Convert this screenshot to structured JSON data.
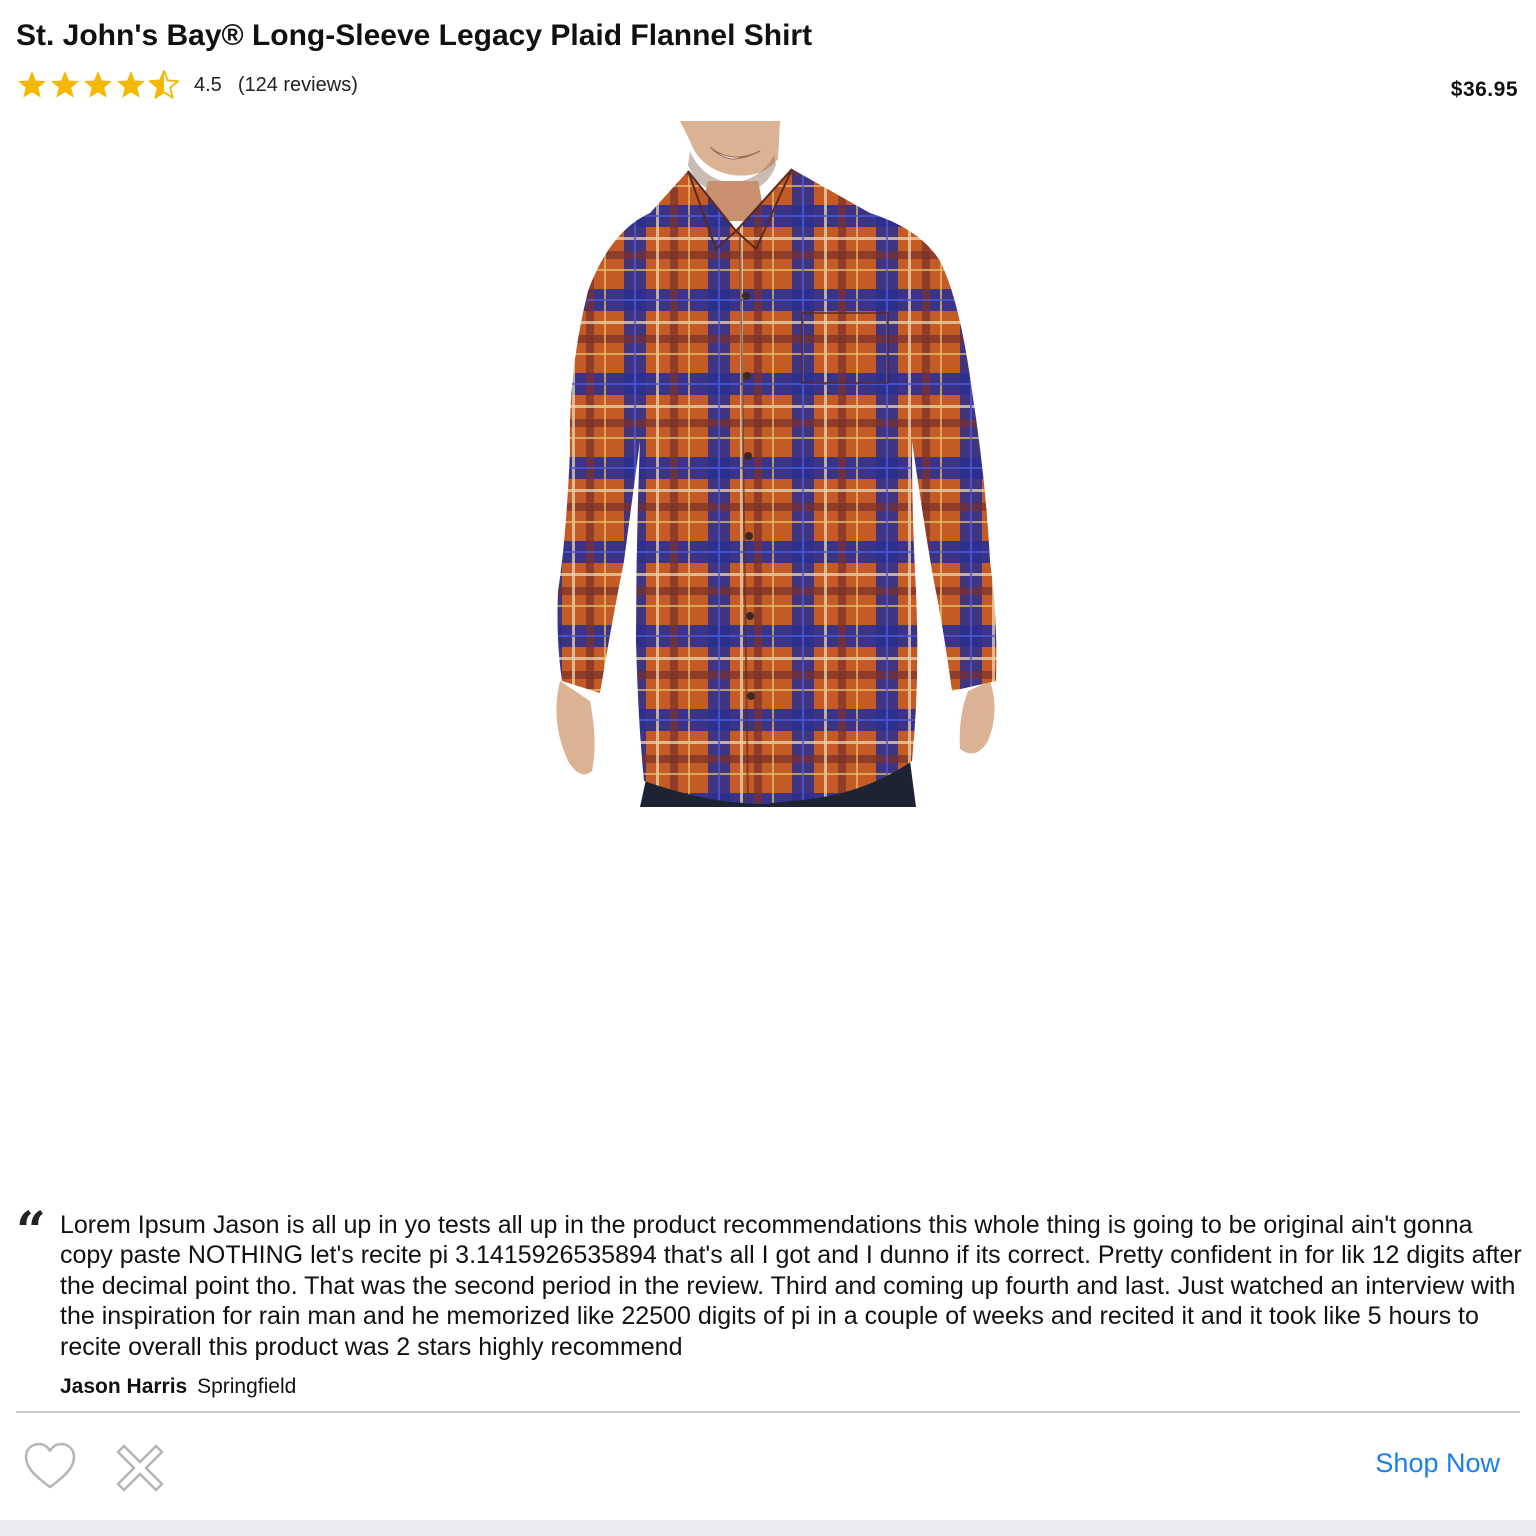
{
  "product": {
    "title": "St. John's Bay® Long-Sleeve Legacy Plaid Flannel Shirt",
    "rating": 4.5,
    "rating_text": "4.5",
    "max_stars": 5,
    "review_count_text": "(124 reviews)",
    "price": "$36.95",
    "image_icon": "plaid-flannel-shirt-photo"
  },
  "review": {
    "text": "Lorem Ipsum Jason is all up in yo tests all up in the product recommendations this whole thing is going to be original ain't gonna copy paste NOTHING let's recite pi 3.1415926535894 that's all I got and I dunno if its correct. Pretty confident in for lik 12 digits after the decimal point tho. That was the second period in the review. Third and coming up fourth and last. Just watched an interview with the inspiration for rain man and he memorized like 22500 digits of pi in a couple of weeks and recited it and it took like 5 hours to recite overall this product was 2 stars highly recommend",
    "quote_mark": "“",
    "author": "Jason Harris",
    "location": "Springfield"
  },
  "actions": {
    "like_icon": "heart-outline-icon",
    "dismiss_icon": "x-outline-icon",
    "shop_label": "Shop Now"
  },
  "colors": {
    "star": "#f5b800",
    "link": "#1a7ef0",
    "icon_stroke": "#b5b5b5",
    "divider": "#c9c9c9"
  }
}
